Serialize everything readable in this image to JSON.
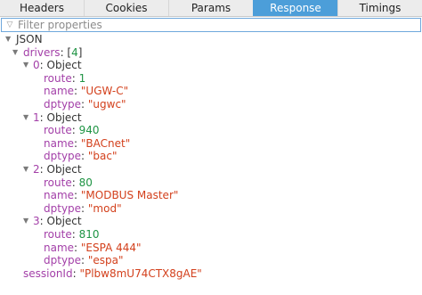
{
  "tabs": [
    {
      "label": "Headers",
      "selected": false
    },
    {
      "label": "Cookies",
      "selected": false
    },
    {
      "label": "Params",
      "selected": false
    },
    {
      "label": "Response",
      "selected": true
    },
    {
      "label": "Timings",
      "selected": false
    }
  ],
  "filter": {
    "placeholder": "Filter properties",
    "value": ""
  },
  "tree": {
    "root_label": "JSON",
    "drivers": {
      "key": "drivers",
      "count": "4",
      "items": [
        {
          "index": "0",
          "type": "Object",
          "route": "1",
          "name": "\"UGW-C\"",
          "dptype": "\"ugwc\""
        },
        {
          "index": "1",
          "type": "Object",
          "route": "940",
          "name": "\"BACnet\"",
          "dptype": "\"bac\""
        },
        {
          "index": "2",
          "type": "Object",
          "route": "80",
          "name": "\"MODBUS Master\"",
          "dptype": "\"mod\""
        },
        {
          "index": "3",
          "type": "Object",
          "route": "810",
          "name": "\"ESPA 444\"",
          "dptype": "\"espa\""
        }
      ]
    },
    "field_keys": {
      "route": "route",
      "name": "name",
      "dptype": "dptype"
    },
    "sessionId": {
      "key": "sessionId",
      "value": "\"Plbw8mU74CTX8gAE\""
    }
  },
  "colors": {
    "accent": "#4c9ed9",
    "key": "#a33fa8",
    "string": "#d3401c",
    "number": "#1f9444"
  }
}
